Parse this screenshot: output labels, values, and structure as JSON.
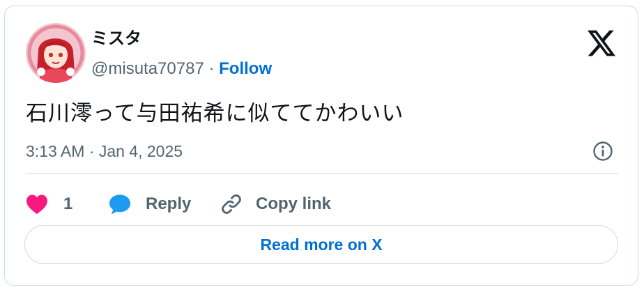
{
  "user": {
    "display_name": "ミスタ",
    "handle": "@misuta70787",
    "separator": " · ",
    "follow_label": "Follow"
  },
  "tweet": {
    "text": "石川澪って与田祐希に似ててかわいい",
    "timestamp": "3:13 AM · Jan 4, 2025"
  },
  "actions": {
    "like_count": "1",
    "reply_label": "Reply",
    "copy_link_label": "Copy link"
  },
  "read_more_label": "Read more on X",
  "icons": {
    "brand": "x-logo-icon",
    "info": "info-icon",
    "like": "heart-icon",
    "reply": "speech-bubble-icon",
    "copy": "link-icon"
  },
  "colors": {
    "link_blue": "#006fd6",
    "heart": "#f91880",
    "reply_blue": "#1d9bf0",
    "muted": "#536471",
    "border": "#cfd9de"
  }
}
